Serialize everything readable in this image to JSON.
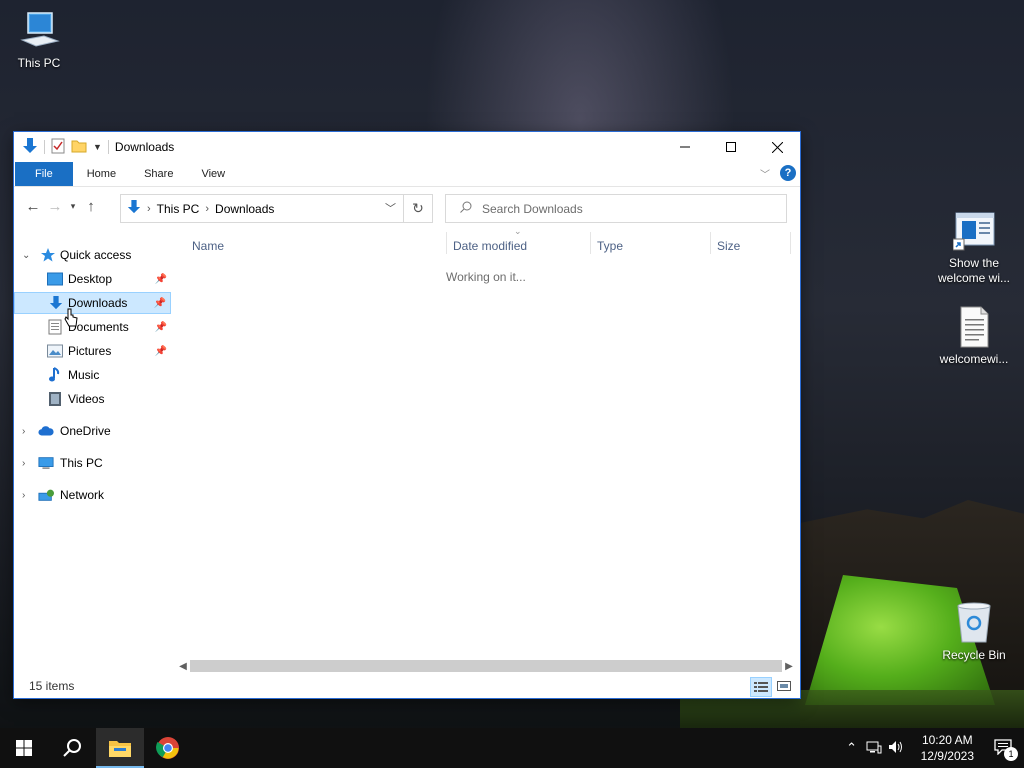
{
  "desktop": {
    "icons": [
      {
        "label": "This PC"
      },
      {
        "label": "Show the welcome wi..."
      },
      {
        "label": "welcomewi..."
      },
      {
        "label": "Recycle Bin"
      }
    ]
  },
  "window": {
    "title": "Downloads",
    "ribbon_tabs": [
      "File",
      "Home",
      "Share",
      "View"
    ],
    "address": {
      "root": "This PC",
      "current": "Downloads"
    },
    "search_placeholder": "Search Downloads",
    "columns": [
      "Name",
      "Date modified",
      "Type",
      "Size"
    ],
    "loading_text": "Working on it...",
    "status": "15 items"
  },
  "nav_pane": {
    "quick_access": "Quick access",
    "pinned": [
      {
        "label": "Desktop",
        "pinned": true
      },
      {
        "label": "Downloads",
        "pinned": true,
        "selected": true
      },
      {
        "label": "Documents",
        "pinned": true
      },
      {
        "label": "Pictures",
        "pinned": true
      },
      {
        "label": "Music",
        "pinned": false
      },
      {
        "label": "Videos",
        "pinned": false
      }
    ],
    "roots": [
      "OneDrive",
      "This PC",
      "Network"
    ]
  },
  "taskbar": {
    "time": "10:20 AM",
    "date": "12/9/2023",
    "notification_count": "1"
  },
  "colors": {
    "accent": "#1a6fc4",
    "selection": "#cce8ff",
    "taskbar": "#101010"
  }
}
